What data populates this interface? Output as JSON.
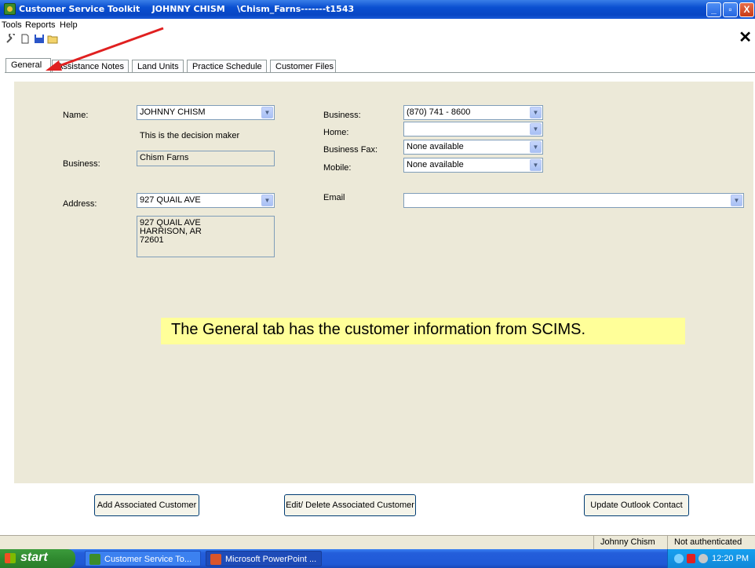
{
  "window": {
    "title": "Customer Service Toolkit    JOHNNY CHISM    \\Chism_Farns-------t1543",
    "minimize": "_",
    "maximize": "▫",
    "close": "X"
  },
  "menu": [
    "Tools",
    "Reports",
    "Help"
  ],
  "toolbar": {
    "close_label": "✕"
  },
  "tabs": [
    "General",
    "Assistance Notes",
    "Land Units",
    "Practice Schedule",
    "Customer Files"
  ],
  "general": {
    "name_label": "Name:",
    "name_value": "JOHNNY CHISM",
    "decision_maker": "This is the decision maker",
    "business_label": "Business:",
    "business_value": "Chism Farns",
    "address_label": "Address:",
    "address_value": "927 QUAIL AVE",
    "address_full": "927 QUAIL AVE\nHARRISON, AR\n72601",
    "phone_business_label": "Business:",
    "phone_business_value": "(870) 741 - 8600",
    "phone_home_label": "Home:",
    "phone_home_value": "",
    "fax_label": "Business Fax:",
    "fax_value": "None available",
    "mobile_label": "Mobile:",
    "mobile_value": "None available",
    "email_label": "Email",
    "email_value": ""
  },
  "callout": "The General tab has the customer information from SCIMS.",
  "buttons": {
    "add_associated": "Add Associated Customer",
    "edit_delete_associated": "Edit/ Delete Associated Customer",
    "update_outlook": "Update Outlook Contact"
  },
  "status": {
    "user": "Johnny Chism",
    "auth": "Not authenticated"
  },
  "taskbar": {
    "start": "start",
    "tasks": [
      "Customer Service To...",
      "Microsoft PowerPoint ..."
    ],
    "clock": "12:20 PM"
  },
  "colors": {
    "accent_red": "#e02020",
    "callout_bg": "#ffff99",
    "panel_bg": "#ece9d8"
  }
}
